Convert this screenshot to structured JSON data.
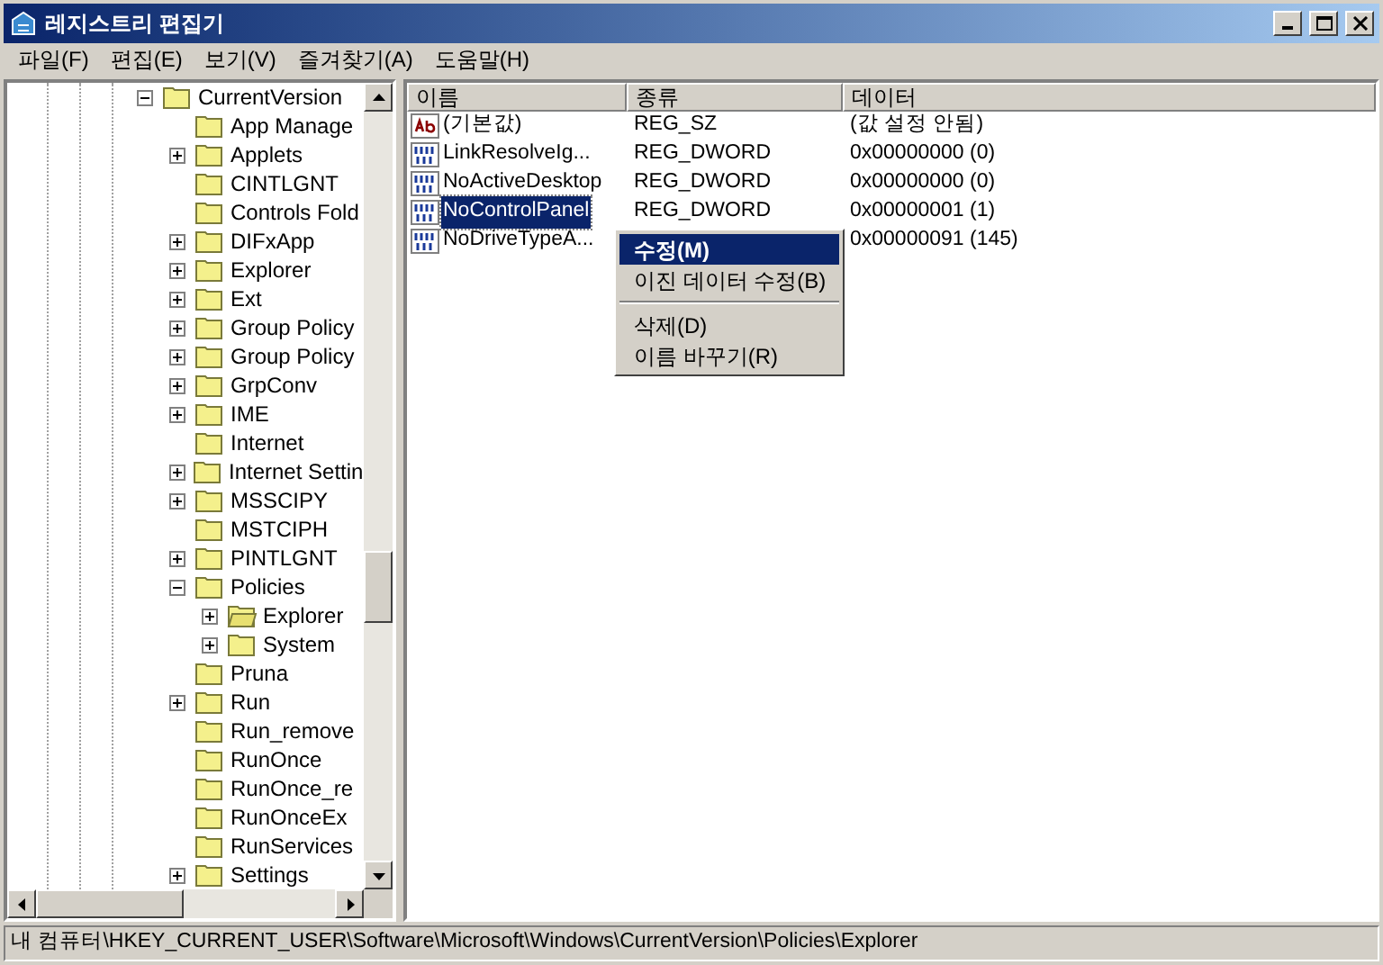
{
  "window": {
    "title": "레지스트리 편집기"
  },
  "menu": [
    "파일(F)",
    "편집(E)",
    "보기(V)",
    "즐겨찾기(A)",
    "도움말(H)"
  ],
  "tree": [
    {
      "label": "CurrentVersion",
      "expanded": true,
      "open": false,
      "children": [
        {
          "label": "App Manage",
          "open": false
        },
        {
          "label": "Applets",
          "expanded": false,
          "open": false
        },
        {
          "label": "CINTLGNT",
          "open": false
        },
        {
          "label": "Controls Fold",
          "open": false
        },
        {
          "label": "DIFxApp",
          "expanded": false,
          "open": false
        },
        {
          "label": "Explorer",
          "expanded": false,
          "open": false
        },
        {
          "label": "Ext",
          "expanded": false,
          "open": false
        },
        {
          "label": "Group Policy",
          "expanded": false,
          "open": false
        },
        {
          "label": "Group Policy",
          "expanded": false,
          "open": false
        },
        {
          "label": "GrpConv",
          "expanded": false,
          "open": false
        },
        {
          "label": "IME",
          "expanded": false,
          "open": false
        },
        {
          "label": "Internet",
          "open": false
        },
        {
          "label": "Internet Settin",
          "expanded": false,
          "open": false
        },
        {
          "label": "MSSCIPY",
          "expanded": false,
          "open": false
        },
        {
          "label": "MSTCIPH",
          "open": false
        },
        {
          "label": "PINTLGNT",
          "expanded": false,
          "open": false
        },
        {
          "label": "Policies",
          "expanded": true,
          "open": false,
          "children": [
            {
              "label": "Explorer",
              "expanded": false,
              "open": true
            },
            {
              "label": "System",
              "expanded": false,
              "open": false
            }
          ]
        },
        {
          "label": "Pruna",
          "open": false
        },
        {
          "label": "Run",
          "expanded": false,
          "open": false
        },
        {
          "label": "Run_remove",
          "open": false
        },
        {
          "label": "RunOnce",
          "open": false
        },
        {
          "label": "RunOnce_re",
          "open": false
        },
        {
          "label": "RunOnceEx",
          "open": false
        },
        {
          "label": "RunServices",
          "open": false
        },
        {
          "label": "Settings",
          "expanded": false,
          "open": false
        }
      ]
    }
  ],
  "list": {
    "columns": [
      "이름",
      "종류",
      "데이터"
    ],
    "rows": [
      {
        "kind": "string",
        "name": "(기본값)",
        "type": "REG_SZ",
        "data": "(값 설정 안됨)",
        "selected": false
      },
      {
        "kind": "binary",
        "name": "LinkResolveIg...",
        "type": "REG_DWORD",
        "data": "0x00000000 (0)",
        "selected": false
      },
      {
        "kind": "binary",
        "name": "NoActiveDesktop",
        "type": "REG_DWORD",
        "data": "0x00000000 (0)",
        "selected": false
      },
      {
        "kind": "binary",
        "name": "NoControlPanel",
        "type": "REG_DWORD",
        "data": "0x00000001 (1)",
        "selected": true
      },
      {
        "kind": "binary",
        "name": "NoDriveTypeA...",
        "data": "0x00000091 (145)",
        "selected": false
      }
    ]
  },
  "context_menu": [
    {
      "kind": "item",
      "label": "수정(M)",
      "selected": true
    },
    {
      "kind": "item",
      "label": "이진 데이터 수정(B)",
      "selected": false
    },
    {
      "kind": "separator"
    },
    {
      "kind": "item",
      "label": "삭제(D)",
      "selected": false
    },
    {
      "kind": "item",
      "label": "이름 바꾸기(R)",
      "selected": false
    }
  ],
  "status_bar": "내 컴퓨터\\HKEY_CURRENT_USER\\Software\\Microsoft\\Windows\\CurrentVersion\\Policies\\Explorer"
}
